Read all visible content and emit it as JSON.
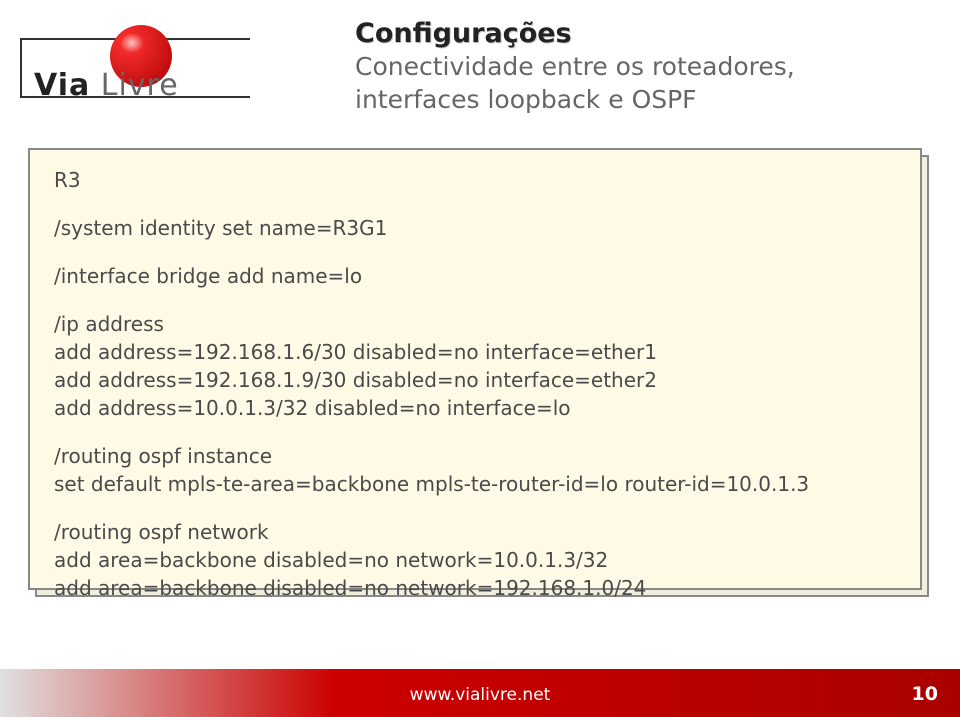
{
  "logo": {
    "brand_part1": "Via",
    "brand_part2": " Livre"
  },
  "header": {
    "title": "Configurações",
    "subtitle": "Conectividade entre os roteadores, interfaces loopback e OSPF"
  },
  "config": {
    "router_label": "R3",
    "system_identity": "/system identity set name=R3G1",
    "interface_bridge": "/interface bridge add name=lo",
    "ip_address_header": "/ip address",
    "ip_addresses": [
      "add address=192.168.1.6/30 disabled=no interface=ether1",
      "add address=192.168.1.9/30 disabled=no interface=ether2",
      "add address=10.0.1.3/32 disabled=no interface=lo"
    ],
    "ospf_instance_header": "/routing ospf instance",
    "ospf_instance_line": "set default mpls-te-area=backbone mpls-te-router-id=lo router-id=10.0.1.3",
    "ospf_network_header": "/routing ospf network",
    "ospf_networks": [
      "add area=backbone disabled=no network=10.0.1.3/32",
      "add area=backbone disabled=no network=192.168.1.0/24"
    ]
  },
  "footer": {
    "url": "www.vialivre.net",
    "page": "10"
  }
}
